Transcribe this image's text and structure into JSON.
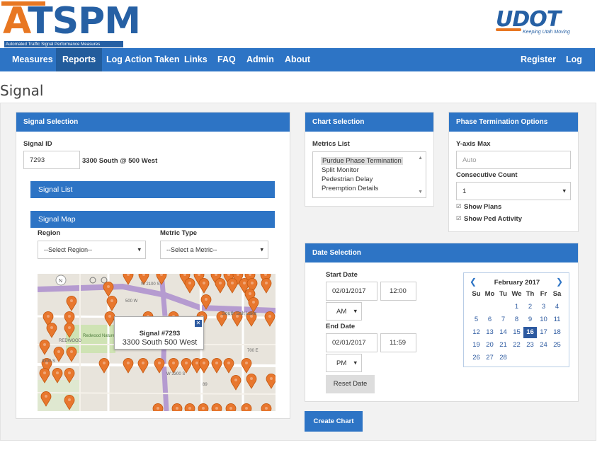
{
  "header": {
    "logo_text_a": "A",
    "logo_text_rest": "TSPM",
    "logo_subtitle": "Automated Traffic Signal Performance Measures",
    "udot_text": "UDOT",
    "udot_tagline": "Keeping Utah Moving"
  },
  "nav": {
    "items": [
      {
        "label": "Measures"
      },
      {
        "label": "Reports"
      },
      {
        "label": "Log Action Taken"
      },
      {
        "label": "Links"
      },
      {
        "label": "FAQ"
      },
      {
        "label": "Admin"
      },
      {
        "label": "About"
      },
      {
        "label": "Register"
      },
      {
        "label": "Log in"
      }
    ]
  },
  "page": {
    "title": "Signal"
  },
  "signal_selection": {
    "heading": "Signal Selection",
    "signal_id_label": "Signal ID",
    "signal_id_value": "7293",
    "signal_name": "3300 South @ 500 West",
    "signal_list_label": "Signal List",
    "signal_map_label": "Signal Map",
    "region_label": "Region",
    "region_value": "--Select Region--",
    "metric_type_label": "Metric Type",
    "metric_type_value": "--Select a Metric--"
  },
  "map": {
    "popup_title": "Signal #7293",
    "popup_subtitle": "3300 South 500 West",
    "place_labels": [
      "Redwood Nature Area",
      "REDWOOD",
      "South Salt Lake",
      "3300 S",
      "W 3300 S",
      "W 2100 S",
      "500 W",
      "700 E",
      "89"
    ]
  },
  "chart_selection": {
    "heading": "Chart Selection",
    "metrics_label": "Metrics List",
    "metrics": [
      "Purdue Phase Termination",
      "Split Monitor",
      "Pedestrian Delay",
      "Preemption Details"
    ],
    "selected_metric": "Purdue Phase Termination"
  },
  "phase_options": {
    "heading": "Phase Termination Options",
    "ymax_label": "Y-axis Max",
    "ymax_placeholder": "Auto",
    "consecutive_label": "Consecutive Count",
    "consecutive_value": "1",
    "show_plans_label": "Show Plans",
    "show_plans_checked": true,
    "show_ped_label": "Show Ped Activity",
    "show_ped_checked": true
  },
  "date_selection": {
    "heading": "Date Selection",
    "start_label": "Start Date",
    "start_date": "02/01/2017",
    "start_time": "12:00",
    "start_ampm": "AM",
    "end_label": "End Date",
    "end_date": "02/01/2017",
    "end_time": "11:59",
    "end_ampm": "PM",
    "reset_label": "Reset Date"
  },
  "calendar": {
    "month_label": "February 2017",
    "prev": "❮",
    "next": "❯",
    "dow": [
      "Su",
      "Mo",
      "Tu",
      "We",
      "Th",
      "Fr",
      "Sa"
    ],
    "weeks": [
      [
        "",
        "",
        "",
        "1",
        "2",
        "3",
        "4"
      ],
      [
        "5",
        "6",
        "7",
        "8",
        "9",
        "10",
        "11"
      ],
      [
        "12",
        "13",
        "14",
        "15",
        "16",
        "17",
        "18"
      ],
      [
        "19",
        "20",
        "21",
        "22",
        "23",
        "24",
        "25"
      ],
      [
        "26",
        "27",
        "28",
        "",
        "",
        "",
        ""
      ]
    ],
    "selected_day": "16"
  },
  "create_chart_label": "Create Chart",
  "colors": {
    "primary": "#2d74c5",
    "accent_orange": "#e87722",
    "marker": "#e8772e"
  }
}
